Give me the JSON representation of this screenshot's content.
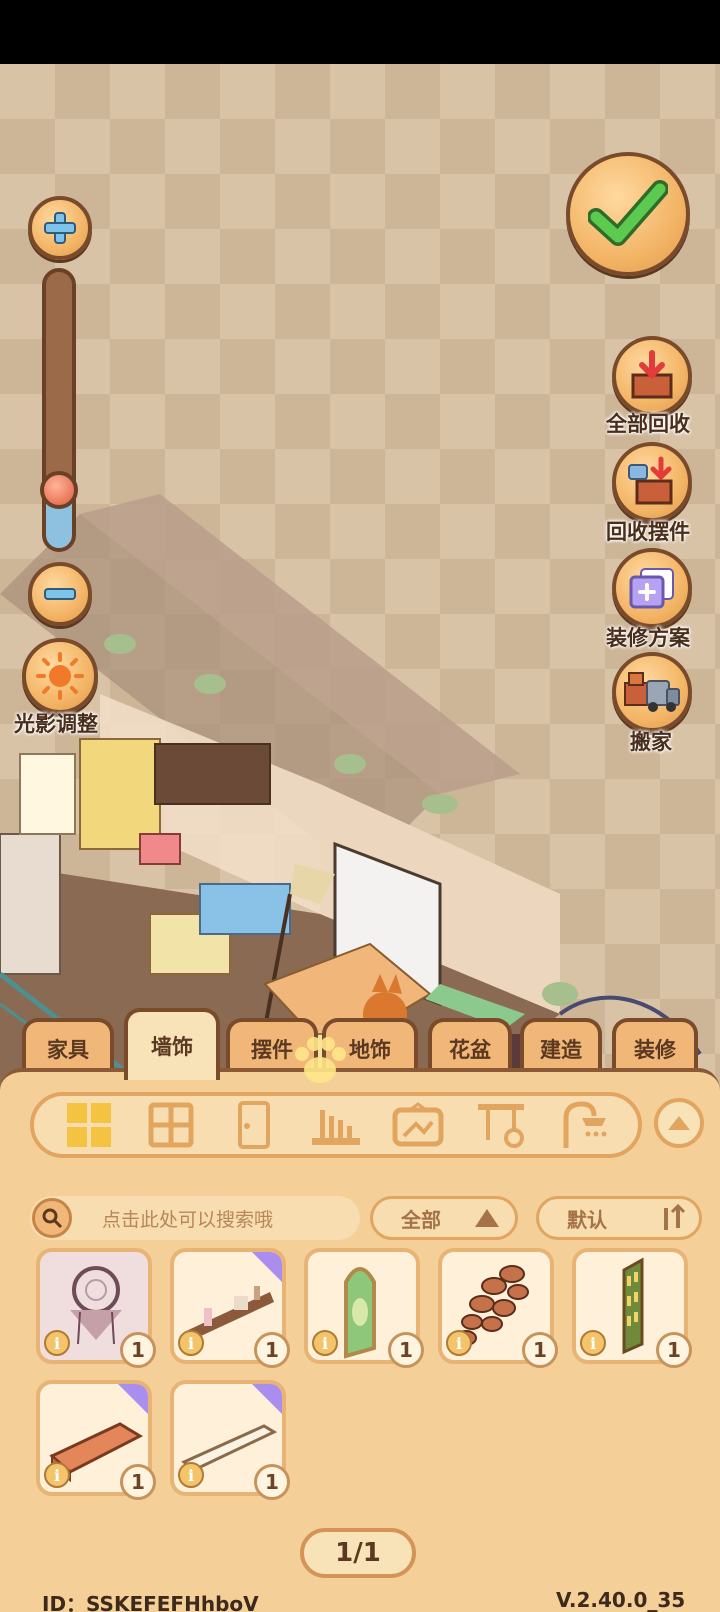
{
  "side_buttons": {
    "light_label": "光影调整",
    "recycle_all_label": "全部回收",
    "recycle_items_label": "回收摆件",
    "plans_label": "装修方案",
    "move_label": "搬家"
  },
  "zoom": {
    "level": 0.22
  },
  "tabs": [
    {
      "label": "家具"
    },
    {
      "label": "墙饰"
    },
    {
      "label": "摆件"
    },
    {
      "label": "地饰"
    },
    {
      "label": "花盆"
    },
    {
      "label": "建造"
    },
    {
      "label": "装修"
    }
  ],
  "active_tab": "墙饰",
  "search": {
    "placeholder": "点击此处可以搜索哦"
  },
  "filter": {
    "label": "全部"
  },
  "sort": {
    "label": "默认"
  },
  "items": [
    {
      "name": "dreamcatcher",
      "count": "1",
      "info": "i"
    },
    {
      "name": "shelf-with-bottles",
      "count": "1",
      "info": "i"
    },
    {
      "name": "arched-window",
      "count": "1",
      "info": "i"
    },
    {
      "name": "stone-wall",
      "count": "1",
      "info": "i"
    },
    {
      "name": "tall-window",
      "count": "1",
      "info": "i"
    },
    {
      "name": "orange-shelf",
      "count": "1",
      "info": "i"
    },
    {
      "name": "white-shelf",
      "count": "1",
      "info": "i"
    }
  ],
  "pager": {
    "text": "1/1"
  },
  "footer": {
    "id": "ID：SSKEFEFHhboV",
    "version": "V.2.40.0_35"
  },
  "colors": {
    "accent": "#f0b779",
    "panel": "#f4cf98",
    "border": "#7a4b2b",
    "check": "#4caf50"
  }
}
